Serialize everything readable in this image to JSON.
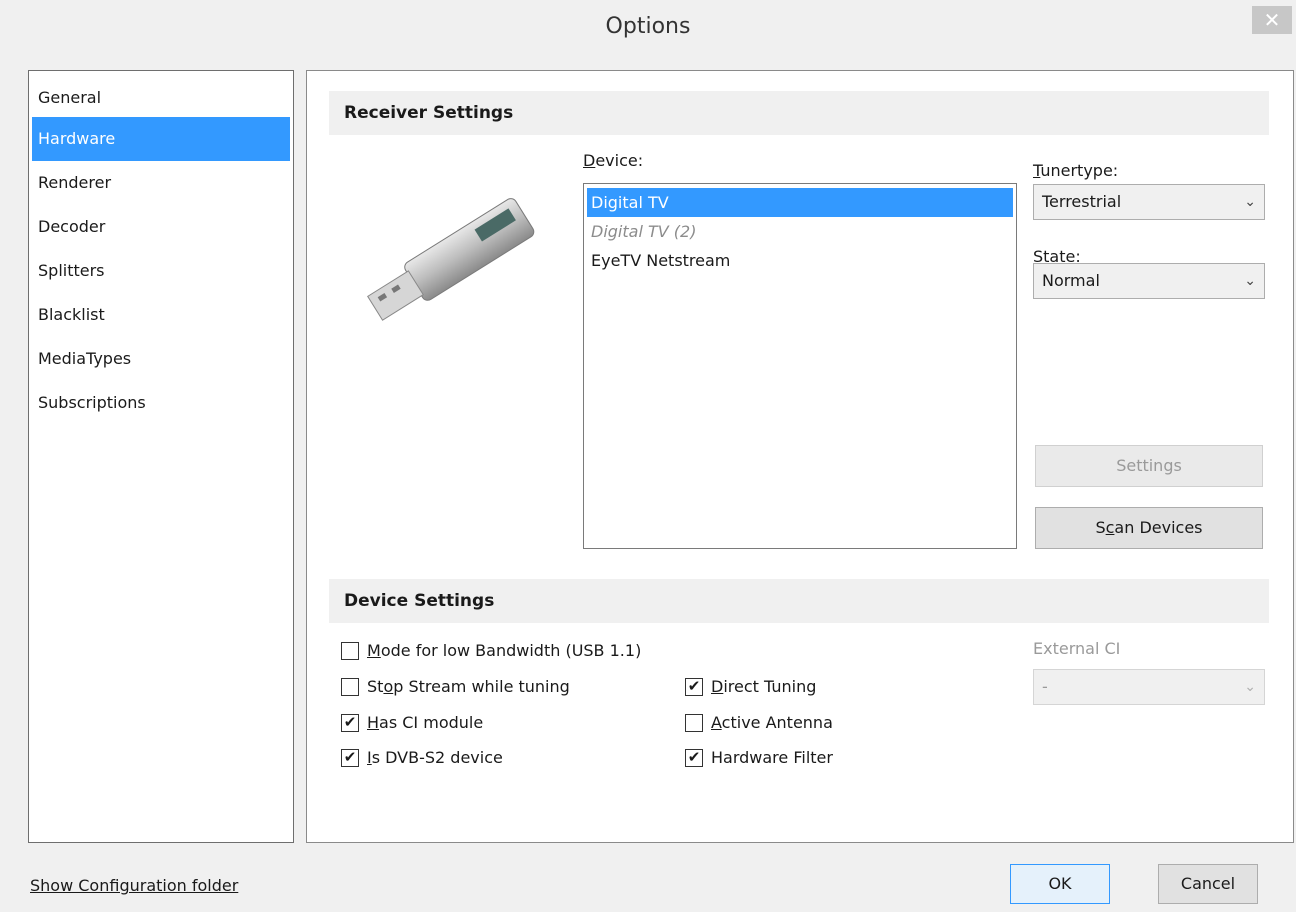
{
  "window": {
    "title": "Options",
    "close_glyph": "✕"
  },
  "sidebar": {
    "items": [
      {
        "label": "General"
      },
      {
        "label": "Hardware"
      },
      {
        "label": "Renderer"
      },
      {
        "label": "Decoder"
      },
      {
        "label": "Splitters"
      },
      {
        "label": "Blacklist"
      },
      {
        "label": "MediaTypes"
      },
      {
        "label": "Subscriptions"
      }
    ],
    "selected": "Hardware"
  },
  "receiver": {
    "header": "Receiver Settings",
    "device_label_u": "D",
    "device_label_rest": "evice:",
    "devices": [
      {
        "name": "Digital TV"
      },
      {
        "name": "Digital TV (2)"
      },
      {
        "name": "EyeTV Netstream"
      }
    ],
    "tunertype_label_u": "T",
    "tunertype_label_rest": "unertype:",
    "tunertype_value": "Terrestrial",
    "state_label_u": "S",
    "state_label_rest": "tate:",
    "state_value": "Normal",
    "settings_button": "Settings",
    "scan_button_pre": "S",
    "scan_button_u": "c",
    "scan_button_post": "an Devices"
  },
  "device_settings": {
    "header": "Device Settings",
    "options": [
      {
        "pre": "",
        "u": "M",
        "post": "ode for low Bandwidth (USB 1.1)",
        "checked": false
      },
      {
        "pre": "St",
        "u": "o",
        "post": "p Stream while tuning",
        "checked": false
      },
      {
        "pre": "",
        "u": "H",
        "post": "as CI module",
        "checked": true
      },
      {
        "pre": "",
        "u": "I",
        "post": "s DVB-S2 device",
        "checked": true
      },
      {
        "pre": "",
        "u": "D",
        "post": "irect Tuning",
        "checked": true
      },
      {
        "pre": "",
        "u": "A",
        "post": "ctive Antenna",
        "checked": false
      },
      {
        "pre": "",
        "u": "",
        "post": "Hardware Filter",
        "checked": true
      }
    ],
    "external_ci_label": "External CI",
    "external_ci_value": "-"
  },
  "footer": {
    "show_config_link": "Show Configuration folder",
    "ok_button": "OK",
    "cancel_button": "Cancel"
  },
  "icons": {
    "checkmark": "✔",
    "chevron": "⌄"
  },
  "colors": {
    "selection": "#3399ff"
  }
}
